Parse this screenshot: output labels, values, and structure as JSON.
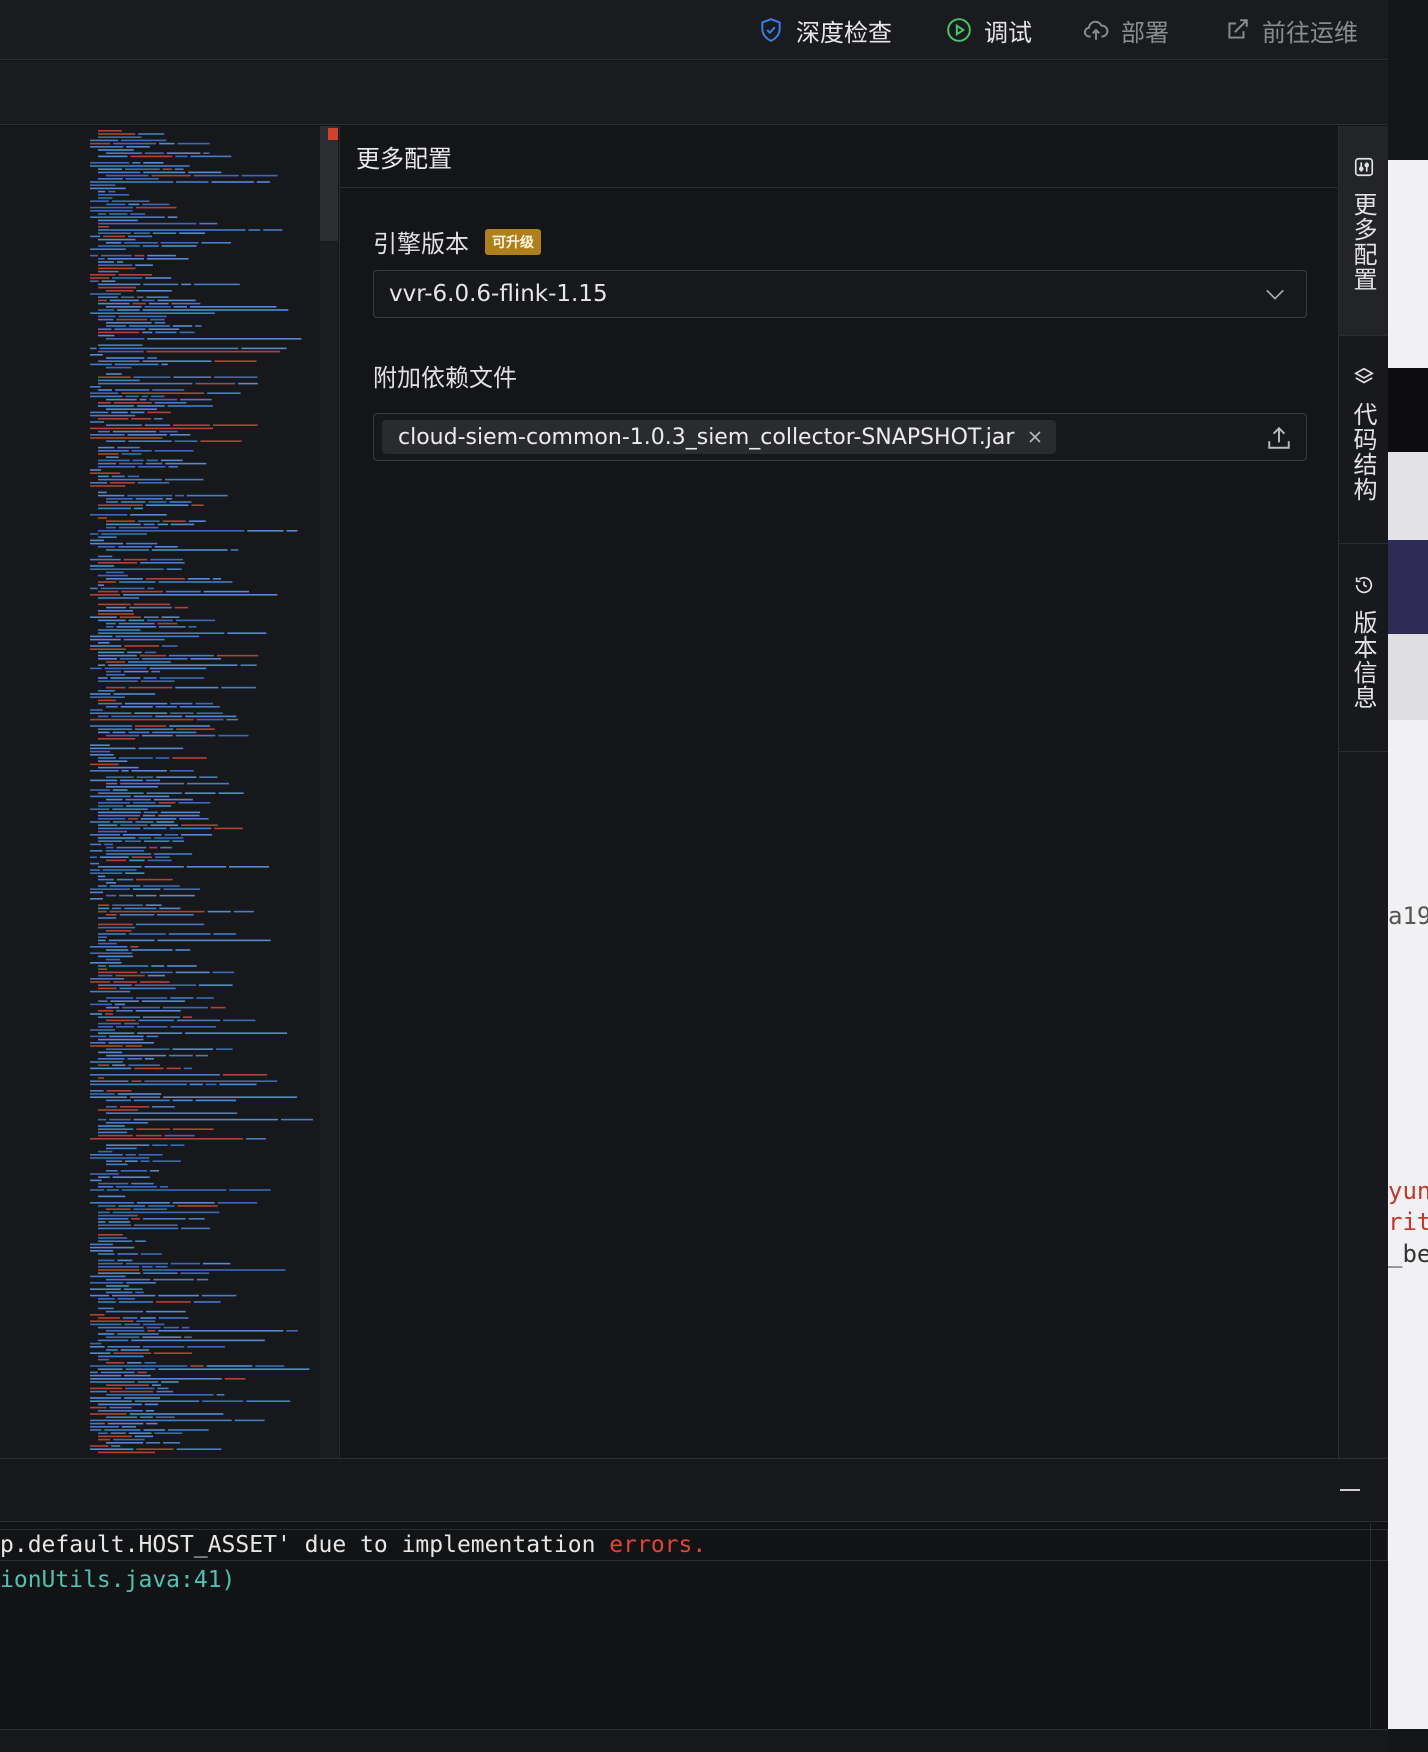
{
  "toolbar": {
    "deep_check": "深度检查",
    "debug": "调试",
    "deploy": "部署",
    "go_ops": "前往运维"
  },
  "panel": {
    "title": "更多配置",
    "engine_version_label": "引擎版本",
    "upgrade_badge": "可升级",
    "engine_version_value": "vvr-6.0.6-flink-1.15",
    "dependency_label": "附加依赖文件",
    "dependency_file": "cloud-siem-common-1.0.3_siem_collector-SNAPSHOT.jar"
  },
  "side_tabs": [
    {
      "label": "更多配置",
      "icon": "sliders-icon"
    },
    {
      "label": "代码结构",
      "icon": "layers-icon"
    },
    {
      "label": "版本信息",
      "icon": "clock-icon"
    }
  ],
  "background_text": {
    "t1": "a19",
    "t2": "yun",
    "t3": "rit",
    "t4": "_be"
  },
  "console": {
    "line1_prefix": "p.default.HOST_ASSET' due to implementation ",
    "line1_error": "errors.",
    "line2": "ionUtils.java:41)"
  },
  "colors": {
    "accent_blue": "#3c7ee8",
    "debug_green": "#4cc36a",
    "badge": "#b07f1d",
    "error_red": "#e0443a"
  }
}
